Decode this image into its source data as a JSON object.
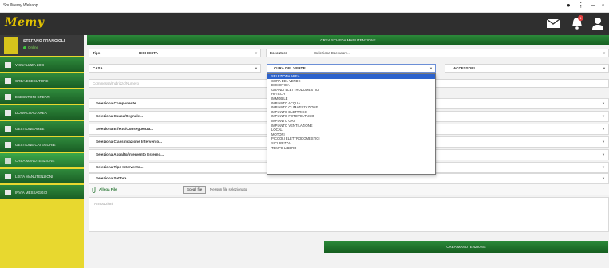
{
  "window": {
    "title": "SoulMemy Webapp"
  },
  "header": {
    "logo_text": "Memy",
    "notification_count": "1"
  },
  "user": {
    "name": "STEFANO FRANCIOLI",
    "status": "Online"
  },
  "sidebar": {
    "items": [
      {
        "label": "Visualizza log"
      },
      {
        "label": "Crea esecutore"
      },
      {
        "label": "Esecutori creati"
      },
      {
        "label": "Download area"
      },
      {
        "label": "Gestione aree"
      },
      {
        "label": "Gestione categorie"
      },
      {
        "label": "Crea manutenzione"
      },
      {
        "label": "Lista manutenzioni"
      },
      {
        "label": "Invia messaggio"
      }
    ]
  },
  "main": {
    "title": "Crea scheda manutenzione",
    "tipo_label": "Tipo",
    "tipo_value": "RICHIESTA",
    "esecutore_label": "Esecutore",
    "esecutore_placeholder": "Seleziona Esecutore...",
    "area_value": "CASA",
    "category_value": "CURA DEL VERDE",
    "accessori_value": "ACCESSORI",
    "description_placeholder": "Commessa/Indirizzo/Numero",
    "selects": [
      "Seleziona Componente...",
      "Seleziona Causa/Segnale...",
      "Seleziona Effetto/Conseguenza...",
      "Seleziona Classificazione Intervento...",
      "Seleziona Appalto/Intervento Esterno...",
      "Seleziona Tipo Intervento...",
      "Seleziona Settore..."
    ],
    "dropdown_options": [
      "Seleziona Area",
      "Cura del verde",
      "Domotica",
      "Grandi elettrodomestici",
      "Hi-Tech",
      "Immobile",
      "Impianto acqua",
      "Impianto climatizzazione",
      "Impianto elettrico",
      "Impianto fotovoltaico",
      "Impianto gas",
      "Impianto ventilazione",
      "Locali",
      "Motori",
      "Piccoli elettrodomestici",
      "Sicurezza",
      "Tempo libero"
    ],
    "dropdown_highlighted": "Seleziona Area",
    "attach_label": "Allega File",
    "file_button": "Scegli file",
    "file_none": "Nessun file selezionato",
    "notes_placeholder": "Annotazioni",
    "submit_label": "Crea manutenzione"
  },
  "colors": {
    "accent_green": "#1f7a2d",
    "sidebar_yellow": "#e8d82f",
    "header_dark": "#2f2f2f",
    "highlight_blue": "#2c62cc"
  }
}
